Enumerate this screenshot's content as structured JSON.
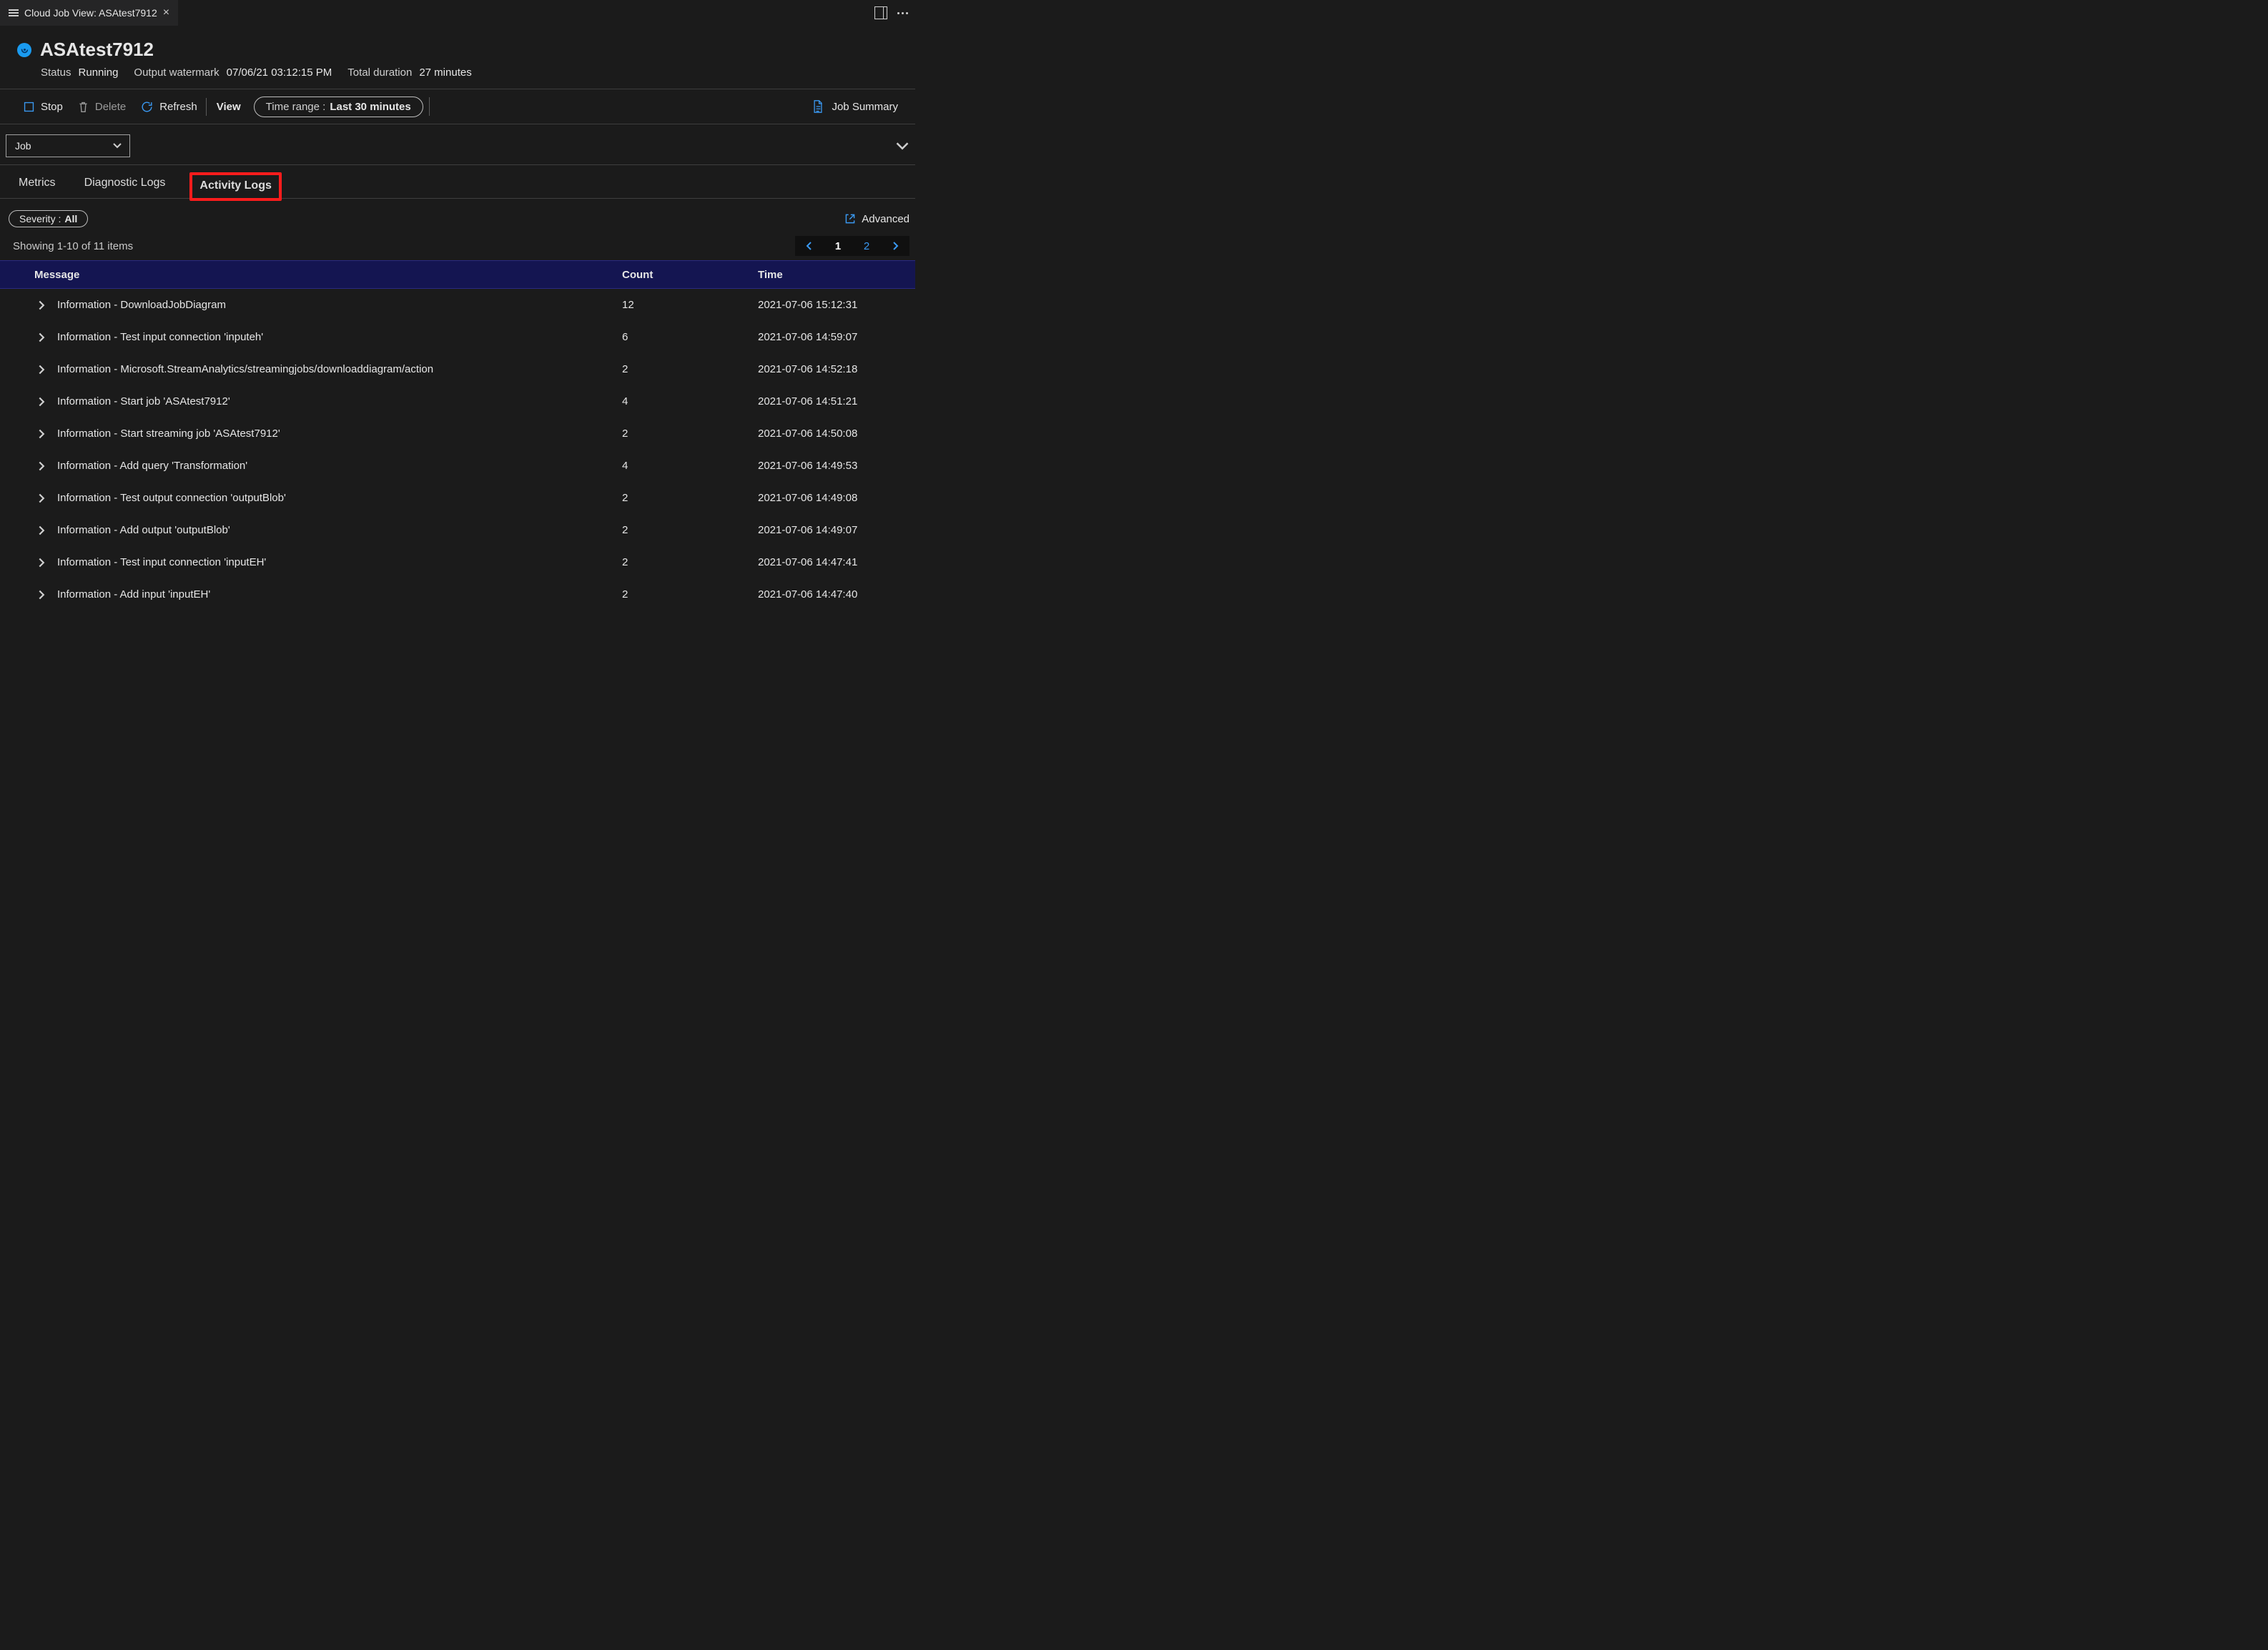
{
  "titlebar": {
    "tab_title": "Cloud Job View: ASAtest7912"
  },
  "job": {
    "name": "ASAtest7912",
    "status_label": "Status",
    "status_value": "Running",
    "watermark_label": "Output watermark",
    "watermark_value": "07/06/21 03:12:15 PM",
    "duration_label": "Total duration",
    "duration_value": "27 minutes"
  },
  "toolbar": {
    "stop": "Stop",
    "delete": "Delete",
    "refresh": "Refresh",
    "view": "View",
    "time_label": "Time range :",
    "time_value": "Last 30 minutes",
    "summary": "Job Summary"
  },
  "dropdown": {
    "value": "Job"
  },
  "subtabs": {
    "metrics": "Metrics",
    "diag": "Diagnostic Logs",
    "activity": "Activity Logs"
  },
  "filter": {
    "sev_label": "Severity :",
    "sev_value": "All",
    "advanced": "Advanced"
  },
  "table": {
    "showing": "Showing 1-10 of 11 items",
    "pages": [
      "1",
      "2"
    ],
    "current_page": "1",
    "headers": {
      "message": "Message",
      "count": "Count",
      "time": "Time"
    },
    "rows": [
      {
        "message": "Information - DownloadJobDiagram",
        "count": "12",
        "time": "2021-07-06 15:12:31"
      },
      {
        "message": "Information - Test input connection 'inputeh'",
        "count": "6",
        "time": "2021-07-06 14:59:07"
      },
      {
        "message": "Information - Microsoft.StreamAnalytics/streamingjobs/downloaddiagram/action",
        "count": "2",
        "time": "2021-07-06 14:52:18"
      },
      {
        "message": "Information - Start job 'ASAtest7912'",
        "count": "4",
        "time": "2021-07-06 14:51:21"
      },
      {
        "message": "Information - Start streaming job 'ASAtest7912'",
        "count": "2",
        "time": "2021-07-06 14:50:08"
      },
      {
        "message": "Information - Add query 'Transformation'",
        "count": "4",
        "time": "2021-07-06 14:49:53"
      },
      {
        "message": "Information - Test output connection 'outputBlob'",
        "count": "2",
        "time": "2021-07-06 14:49:08"
      },
      {
        "message": "Information - Add output 'outputBlob'",
        "count": "2",
        "time": "2021-07-06 14:49:07"
      },
      {
        "message": "Information - Test input connection 'inputEH'",
        "count": "2",
        "time": "2021-07-06 14:47:41"
      },
      {
        "message": "Information - Add input 'inputEH'",
        "count": "2",
        "time": "2021-07-06 14:47:40"
      }
    ]
  }
}
